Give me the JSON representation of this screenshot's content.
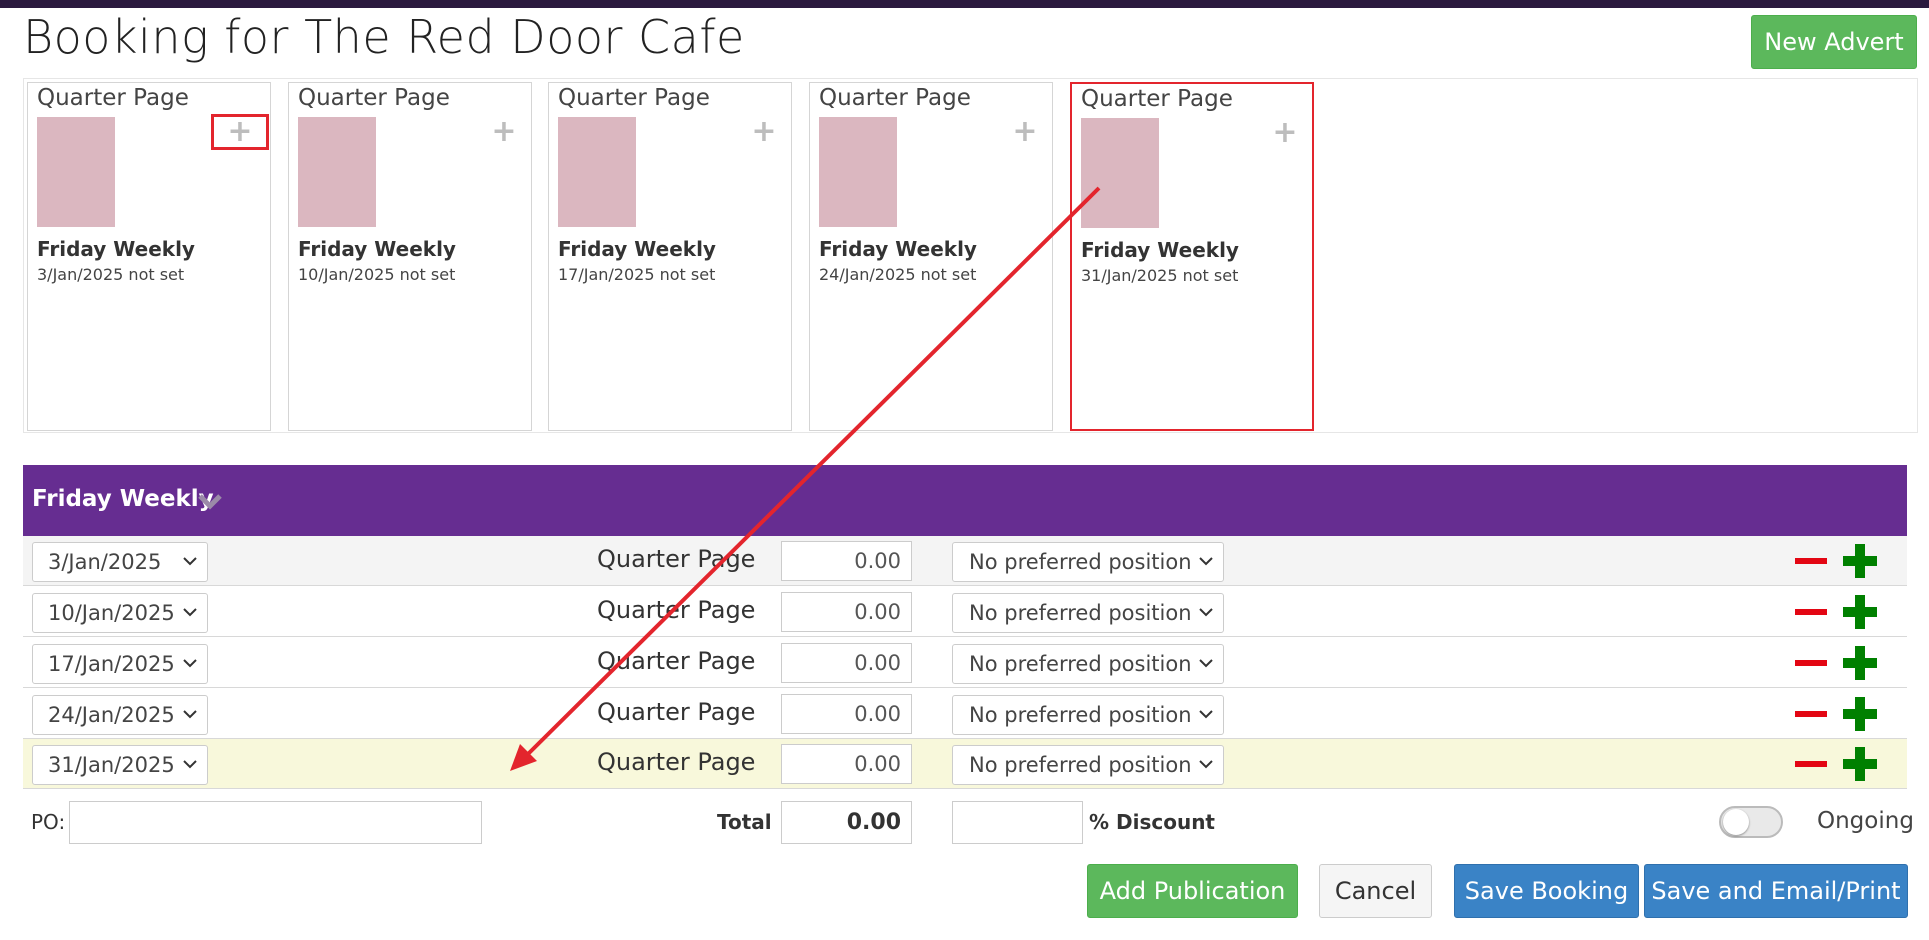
{
  "header": {
    "title": "Booking for The Red Door Cafe",
    "new_advert_label": "New Advert"
  },
  "ad_cards": [
    {
      "size": "Quarter Page",
      "publication": "Friday Weekly",
      "date_status": "3/Jan/2025 not set"
    },
    {
      "size": "Quarter Page",
      "publication": "Friday Weekly",
      "date_status": "10/Jan/2025 not set"
    },
    {
      "size": "Quarter Page",
      "publication": "Friday Weekly",
      "date_status": "17/Jan/2025 not set"
    },
    {
      "size": "Quarter Page",
      "publication": "Friday Weekly",
      "date_status": "24/Jan/2025 not set"
    },
    {
      "size": "Quarter Page",
      "publication": "Friday Weekly",
      "date_status": "31/Jan/2025 not set"
    }
  ],
  "section": {
    "title": "Friday Weekly",
    "color": "#662d91"
  },
  "rows": [
    {
      "date": "3/Jan/2025",
      "size": "Quarter Page",
      "price": "0.00",
      "position": "No preferred position"
    },
    {
      "date": "10/Jan/2025",
      "size": "Quarter Page",
      "price": "0.00",
      "position": "No preferred position"
    },
    {
      "date": "17/Jan/2025",
      "size": "Quarter Page",
      "price": "0.00",
      "position": "No preferred position"
    },
    {
      "date": "24/Jan/2025",
      "size": "Quarter Page",
      "price": "0.00",
      "position": "No preferred position"
    },
    {
      "date": "31/Jan/2025",
      "size": "Quarter Page",
      "price": "0.00",
      "position": "No preferred position"
    }
  ],
  "footer": {
    "po_label": "PO:",
    "po_value": "",
    "total_label": "Total",
    "total_value": "0.00",
    "discount_value": "",
    "discount_label": "% Discount",
    "ongoing_label": "Ongoing",
    "ongoing_on": false
  },
  "actions": {
    "add_publication": "Add Publication",
    "cancel": "Cancel",
    "save_booking": "Save Booking",
    "save_email_print": "Save and Email/Print"
  },
  "icons": {
    "add_card": "plus-icon",
    "remove_row": "minus-icon",
    "add_row": "plus-icon",
    "section_toggle": "chevron-down-icon"
  },
  "colors": {
    "accent_purple": "#662d91",
    "success_green": "#5cb85c",
    "primary_blue": "#3a83c6",
    "annotation_red": "#e3252d",
    "thumbnail_pink": "#dbb7c0",
    "highlight_row": "#f8f8db"
  }
}
